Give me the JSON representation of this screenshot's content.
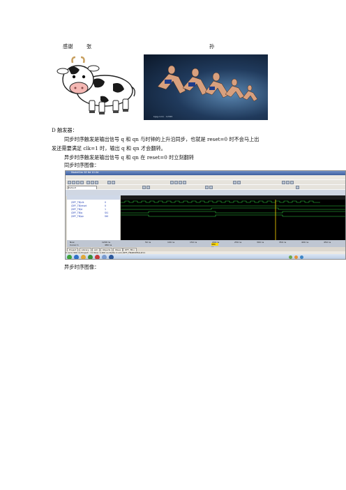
{
  "thanks": {
    "word": "感谢",
    "name1": "张",
    "name2": "孙"
  },
  "runners_caption": "bjpg.com/ · 12345",
  "dff_heading": "D 触发器：",
  "para1_line1": "同步时序触发是输出信号 q 和 qn 与时钟的上升沿同步，也就是 reset=0 时不会马上出",
  "para1_line2": "发还需要满足 clk=1 时，输出 q 和 qn 才会翻转。",
  "para2": "异步时序触发是输出信号 q 和 qn 在 reset=0 时立刻翻转",
  "sync_label": "同步时序图像：",
  "async_label": "异步时序图像：",
  "screenshot": {
    "title": "ModelSim SE 6d 10.0d",
    "menus": [
      "File",
      "Edit",
      "View",
      "Compile",
      "Simulate",
      "Add",
      "Wave",
      "Tools",
      "Layout",
      "Window",
      "Help"
    ],
    "layout_select": "Default",
    "signals": [
      {
        "name": "/DFF_TB/clk",
        "value": "0"
      },
      {
        "name": "/DFF_TB/reset",
        "value": "0"
      },
      {
        "name": "/DFF_TB/d",
        "value": "1"
      },
      {
        "name": "/DFF_TB/q",
        "value": "St1"
      },
      {
        "name": "/DFF_TB/qn",
        "value": "St0"
      }
    ],
    "now_label": "Now",
    "now_value": "1200 ns",
    "cursor_label": "Cursor 1",
    "cursor_value": "480 ns",
    "cursor_box": "480 ns",
    "ticks": [
      "50 ns",
      "100 ns",
      "150 ns",
      "200 ns",
      "250 ns",
      "300 ns",
      "350 ns",
      "400 ns",
      "450 ns"
    ],
    "tabs": [
      "Project",
      "Library",
      "sim",
      "Objects",
      "Wave",
      "DFF_TB.v"
    ],
    "status": "0 ns to 500 ns      Project : 11  Now: 1,200 ns  Delta: 0        sim:/DFF_TB/#INITIAL#11"
  }
}
